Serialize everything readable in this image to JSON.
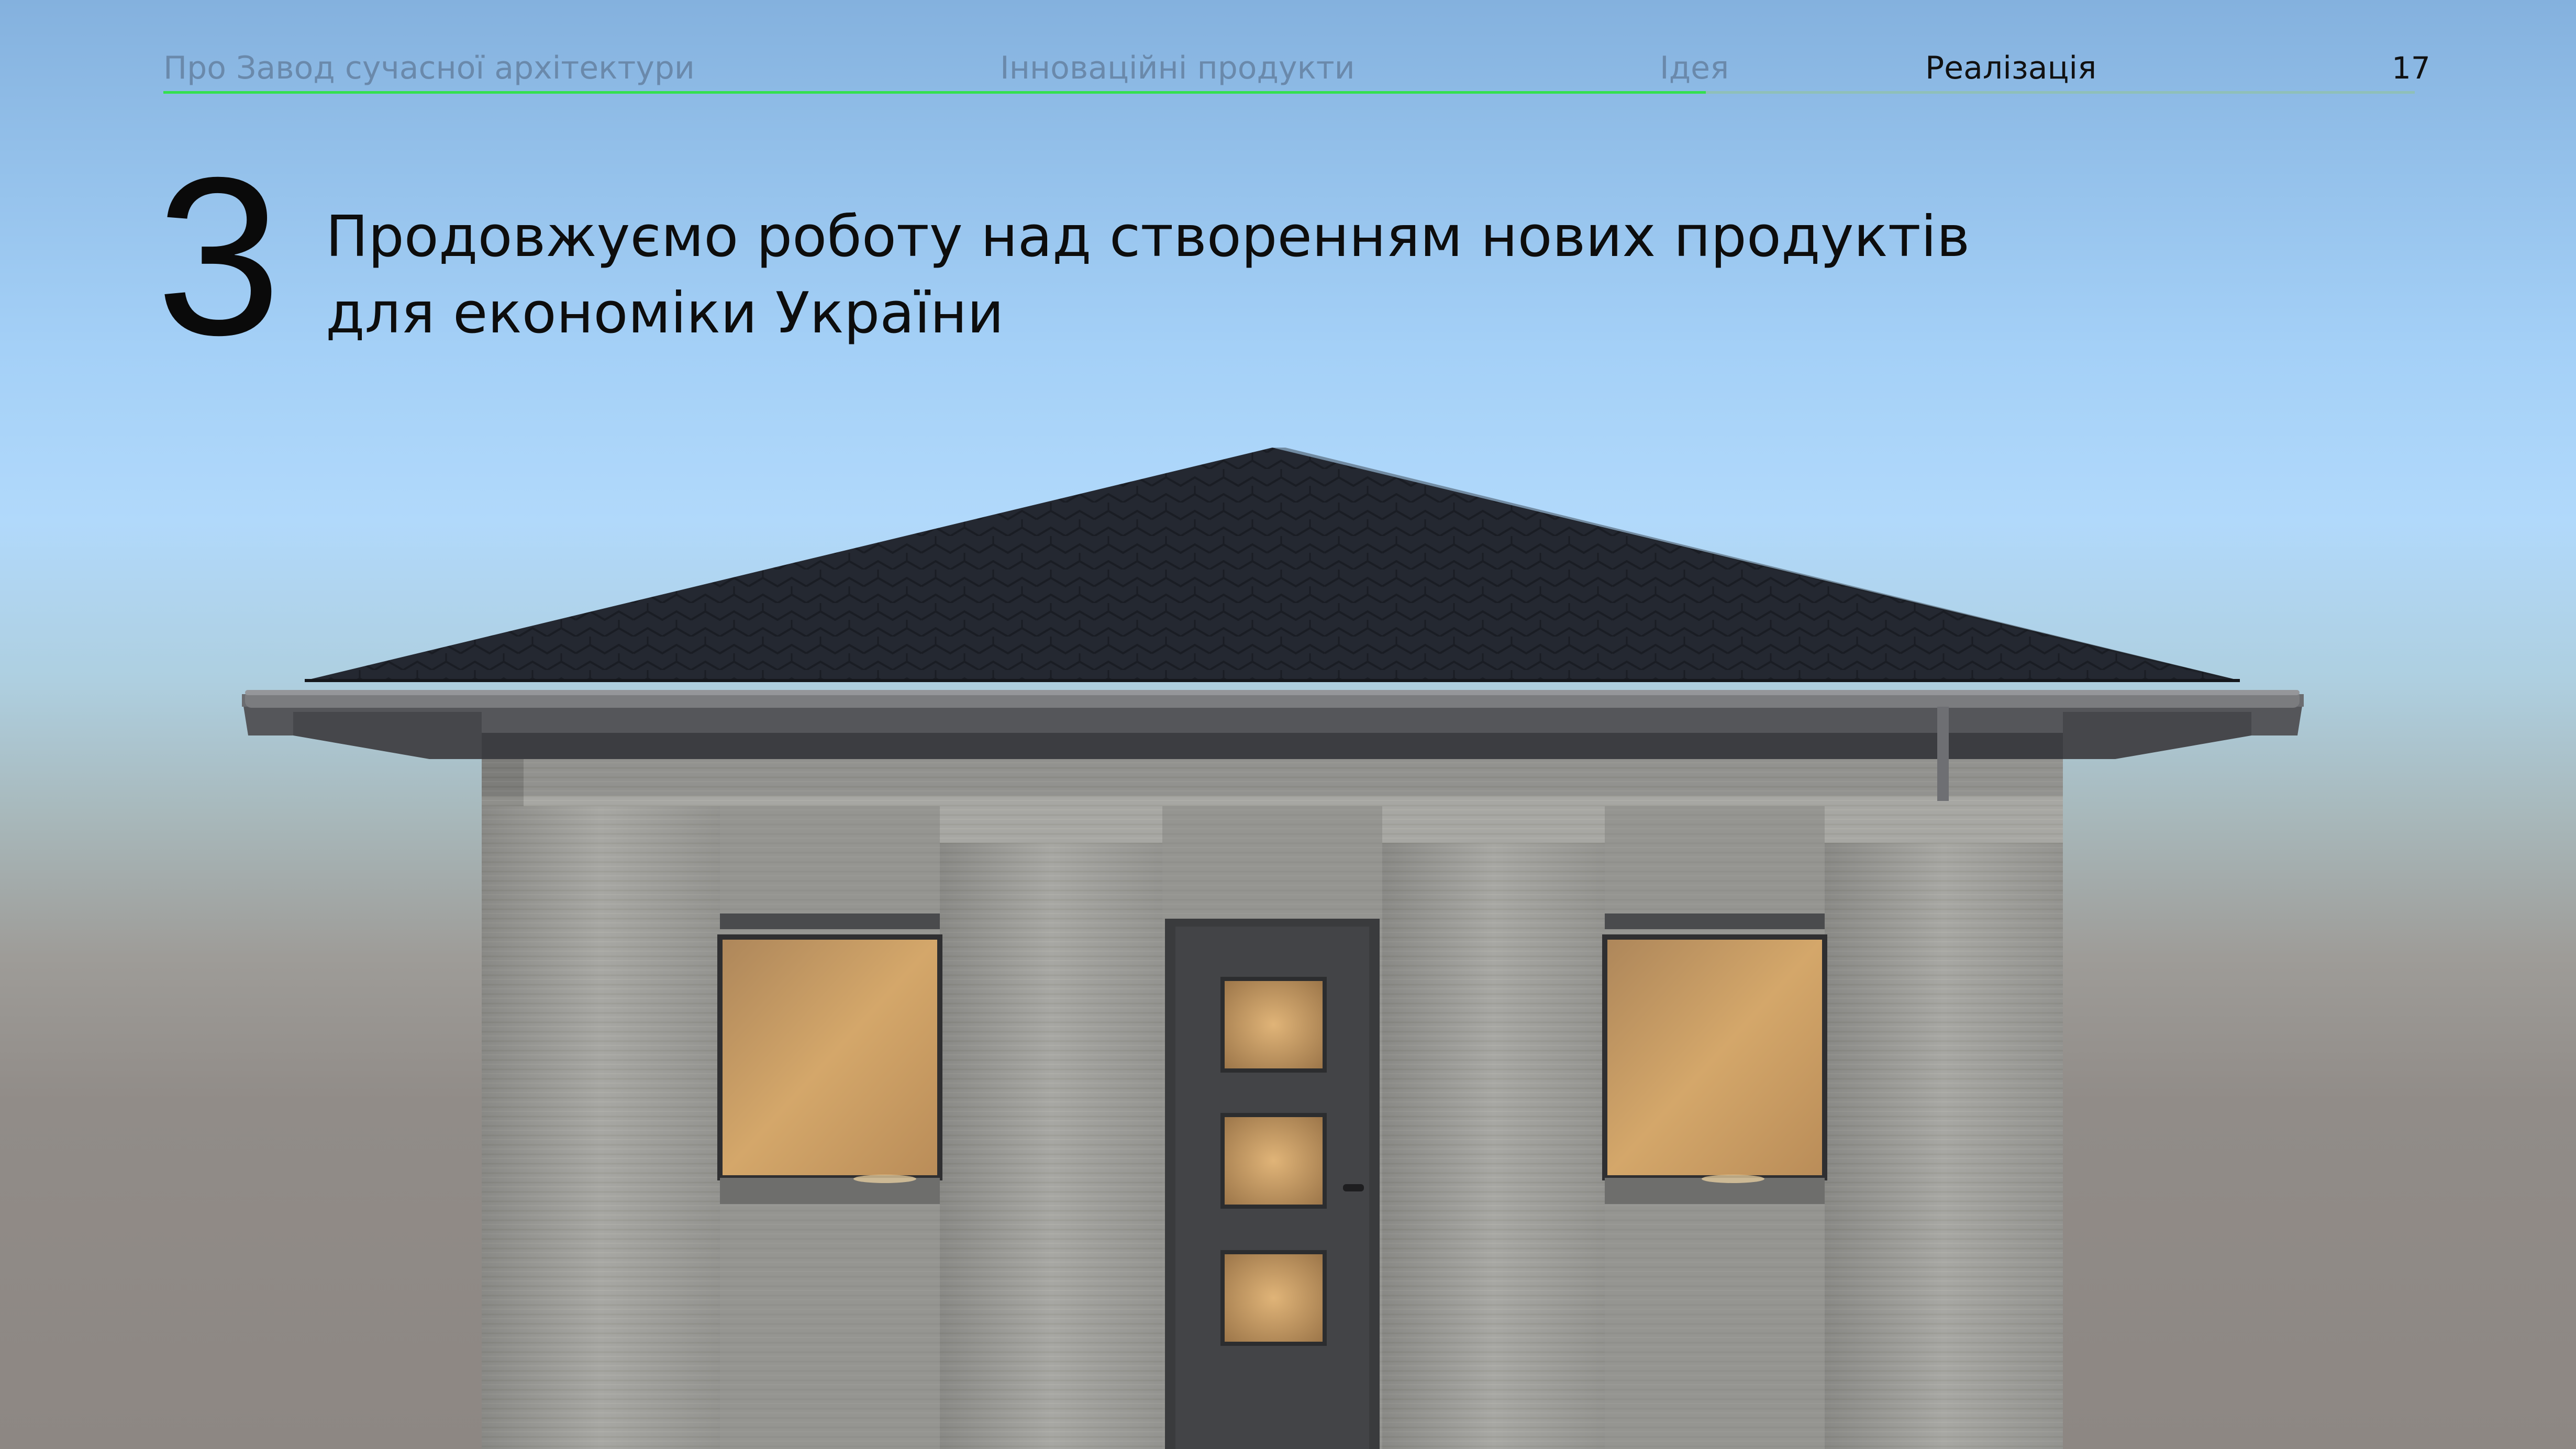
{
  "nav": {
    "items": [
      {
        "label": "Про Завод сучасної архітектури",
        "active": false
      },
      {
        "label": "Інноваційні продукти",
        "active": false
      },
      {
        "label": "Ідея",
        "active": false
      },
      {
        "label": "Реалізація",
        "active": true
      }
    ],
    "page_number": "17",
    "progress": 0.685
  },
  "heading": {
    "step_number": "3",
    "line1": "Продовжуємо роботу над створенням нових продуктів",
    "line2": "для економіки України"
  },
  "colors": {
    "accent": "#34e04e",
    "nav_inactive": "#6a89ab",
    "text": "#0d0d0d",
    "roof": "#22262f",
    "wall": "#a6a6a2",
    "window_glow": "#c99a5e"
  }
}
